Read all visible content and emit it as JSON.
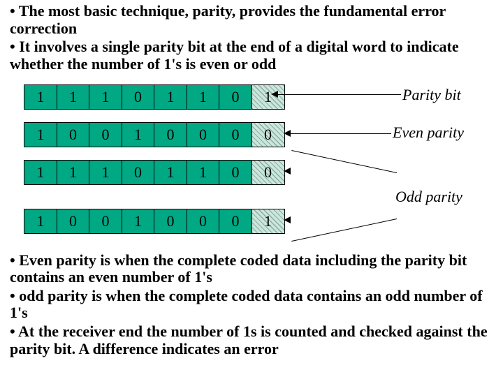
{
  "bullets_top": [
    "• The most basic technique, parity, provides the fundamental error correction",
    "• It involves a single parity bit at the end of a digital word to indicate whether the number of 1's is even or odd"
  ],
  "rows": [
    {
      "bits": [
        "1",
        "1",
        "1",
        "0",
        "1",
        "1",
        "0"
      ],
      "parity": "1"
    },
    {
      "bits": [
        "1",
        "0",
        "0",
        "1",
        "0",
        "0",
        "0"
      ],
      "parity": "0"
    },
    {
      "bits": [
        "1",
        "1",
        "1",
        "0",
        "1",
        "1",
        "0"
      ],
      "parity": "0"
    },
    {
      "bits": [
        "1",
        "0",
        "0",
        "1",
        "0",
        "0",
        "0"
      ],
      "parity": "1"
    }
  ],
  "labels": {
    "parity_bit": "Parity bit",
    "even_parity": "Even parity",
    "odd_parity": "Odd parity"
  },
  "bullets_bottom": [
    "• Even parity is when the complete coded data including the parity bit contains an even number of 1's",
    "• odd parity is when the complete coded data contains an odd number of 1's",
    "• At the receiver end the number of 1s is counted and checked against the parity bit. A difference indicates an error"
  ]
}
